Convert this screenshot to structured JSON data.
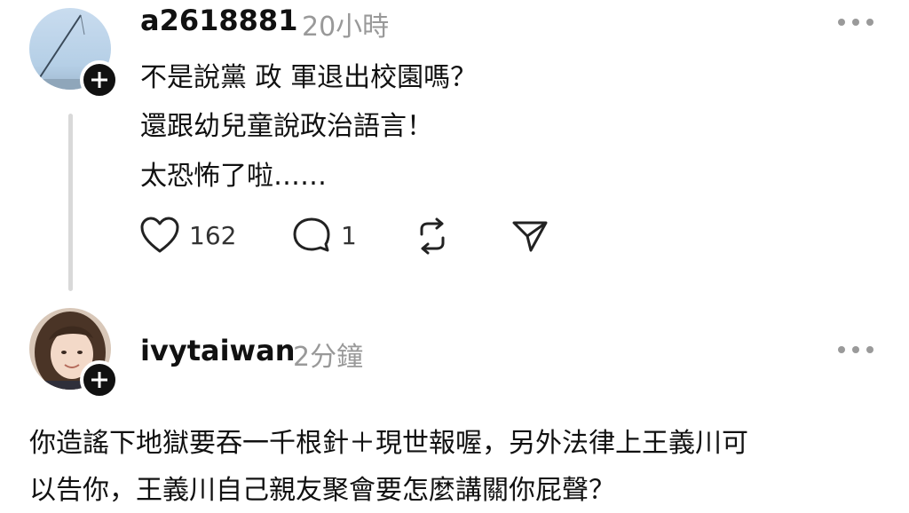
{
  "post1": {
    "username": "a2618881",
    "timestamp": "20小時",
    "lines": [
      "不是說黨 政 軍退出校園嗎？",
      "還跟幼兒童說政治語言！",
      "太恐怖了啦……"
    ],
    "actions": {
      "like_count": "162",
      "comment_count": "1"
    },
    "icons": [
      "heart-icon",
      "comment-icon",
      "repost-icon",
      "share-icon",
      "more-icon",
      "plus-icon"
    ]
  },
  "post2": {
    "username": "ivytaiwan",
    "timestamp": "2分鐘",
    "lines": [
      "你造謠下地獄要吞一千根針＋現世報喔，另外法律上王義川可",
      "以告你，王義川自己親友聚會要怎麼講關你屁聲？"
    ],
    "icons": [
      "more-icon",
      "plus-icon"
    ]
  },
  "colors": {
    "text": "#111111",
    "muted": "#999999",
    "thread_line": "#d9d9d9",
    "badge": "#111111"
  }
}
